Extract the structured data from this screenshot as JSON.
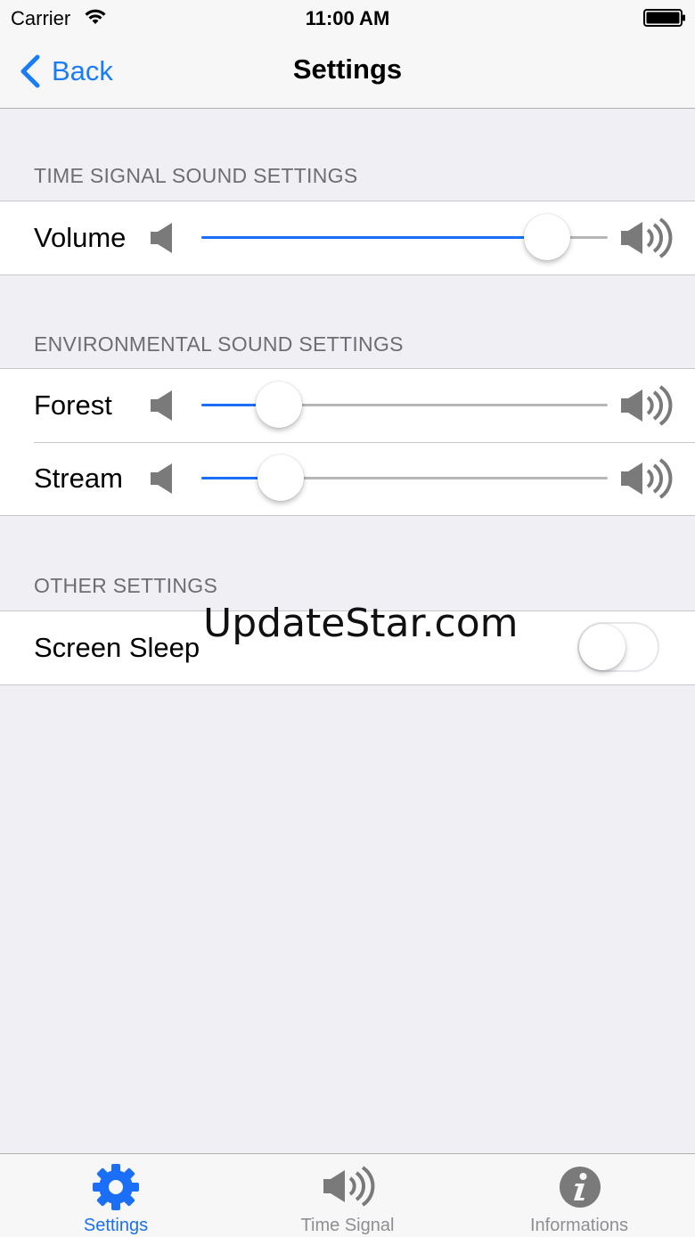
{
  "status": {
    "carrier": "Carrier",
    "time": "11:00 AM"
  },
  "nav": {
    "back_label": "Back",
    "title": "Settings"
  },
  "sections": [
    {
      "header": "TIME SIGNAL SOUND SETTINGS",
      "rows": [
        {
          "label": "Volume",
          "value": 0.85
        }
      ]
    },
    {
      "header": "ENVIRONMENTAL SOUND SETTINGS",
      "rows": [
        {
          "label": "Forest",
          "value": 0.19
        },
        {
          "label": "Stream",
          "value": 0.195
        }
      ]
    },
    {
      "header": "OTHER SETTINGS",
      "rows": [
        {
          "label": "Screen Sleep",
          "toggle_on": false
        }
      ]
    }
  ],
  "watermark": "UpdateStar.com",
  "tabs": [
    {
      "label": "Settings",
      "icon": "gear-icon",
      "active": true
    },
    {
      "label": "Time Signal",
      "icon": "speaker-icon",
      "active": false
    },
    {
      "label": "Informations",
      "icon": "info-icon",
      "active": false
    }
  ],
  "colors": {
    "accent": "#1b6ff6",
    "inactive": "#8e8e93",
    "background": "#efeff4"
  }
}
